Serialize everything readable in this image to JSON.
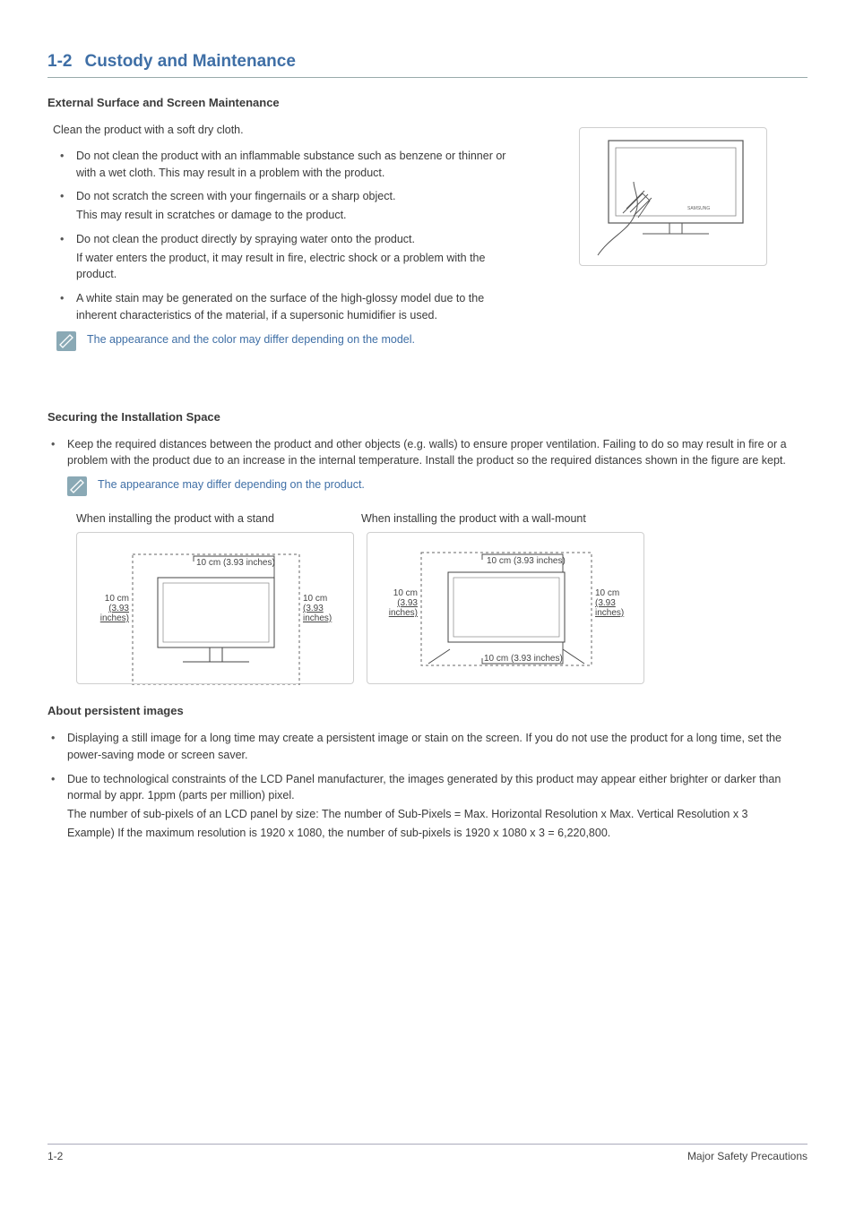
{
  "section": {
    "number": "1-2",
    "title": "Custody and Maintenance"
  },
  "ext": {
    "heading": "External Surface and Screen Maintenance",
    "lead": "Clean the product with a soft dry cloth.",
    "items": [
      {
        "main": "Do not clean the product with an inflammable substance such as benzene or thinner or with a wet cloth. This may result in a problem with the product."
      },
      {
        "main": "Do not scratch the screen with your fingernails or a sharp object.",
        "sub": "This may result in scratches or damage to the product."
      },
      {
        "main": "Do not clean the product directly by spraying water onto the product.",
        "sub": "If water enters the product, it may result in fire, electric shock or a problem with the product."
      },
      {
        "main": "A white stain may be generated on the surface of the high-glossy model due to the inherent characteristics of the material, if a supersonic humidifier is used."
      }
    ],
    "note": "The appearance and the color may differ depending on the model."
  },
  "space": {
    "heading": "Securing the Installation Space",
    "bullet": "Keep the required distances between the product and other objects (e.g. walls) to ensure proper ventilation. Failing to do so may result in fire or a problem with the product due to an increase in the internal temperature. Install the product so the required distances shown in the figure are kept.",
    "note": "The appearance may differ depending on the product.",
    "diag_left_title": "When installing the product with a stand",
    "diag_right_title": "When installing the product with a wall-mount",
    "dim_top": "10 cm (3.93 inches)",
    "dim_left_a": "10 cm",
    "dim_left_b": "(3.93 inches)",
    "dim_right_a": "10 cm",
    "dim_right_b": "(3.93 inches)",
    "dim_bottom": "10 cm (3.93 inches)"
  },
  "persist": {
    "heading": "About persistent images",
    "items": [
      {
        "main": "Displaying a still image for a long time may create a persistent image or stain on the screen. If you do not use the product for a long time, set the power-saving mode or screen saver."
      },
      {
        "main": "Due to technological constraints of the LCD Panel manufacturer, the images generated by this product may appear either brighter or darker than normal by appr. 1ppm (parts per million) pixel.",
        "sub1": "The number of sub-pixels of an LCD panel by size:  The number of Sub-Pixels = Max. Horizontal Resolution x Max. Vertical Resolution x 3",
        "sub2": "Example) If the maximum resolution is 1920 x 1080, the number of sub-pixels is 1920 x 1080 x 3 = 6,220,800."
      }
    ]
  },
  "footer": {
    "left": "1-2",
    "right": "Major Safety Precautions"
  }
}
